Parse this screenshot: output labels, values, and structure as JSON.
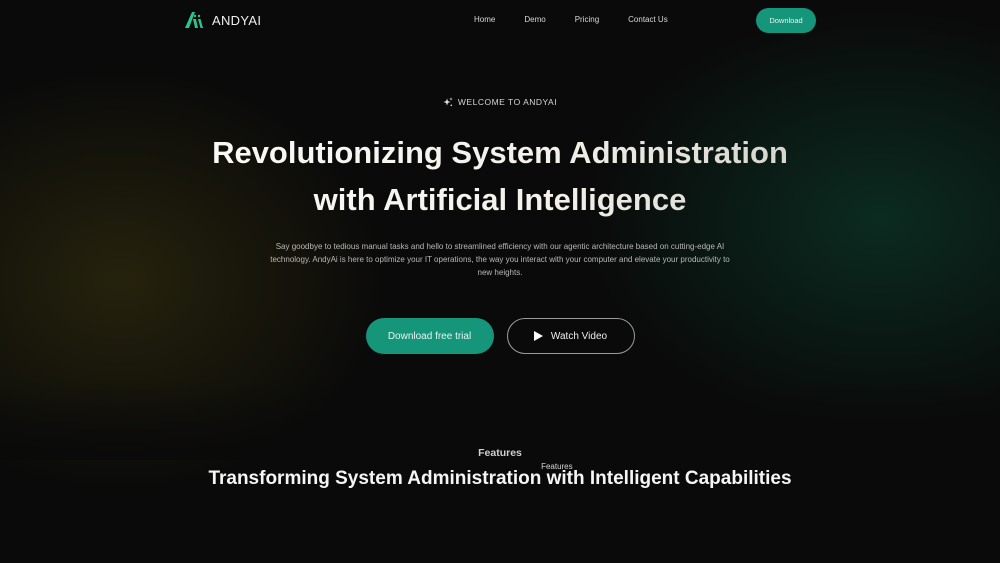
{
  "brand": {
    "name": "ANDYAI",
    "logo_icon": "andyai-logo-icon",
    "accent_color": "#15957a"
  },
  "nav": {
    "links": [
      {
        "label": "Home"
      },
      {
        "label": "Features"
      },
      {
        "label": "Demo"
      },
      {
        "label": "Pricing"
      },
      {
        "label": "Contact Us"
      }
    ],
    "download_label": "Download"
  },
  "hero": {
    "eyebrow_icon": "sparkle-icon",
    "eyebrow": "WELCOME TO ANDYAI",
    "title_line1": "Revolutionizing System Administration",
    "title_line2": "with Artificial Intelligence",
    "subtitle": "Say goodbye to tedious manual tasks and hello to streamlined efficiency with our agentic architecture based on cutting-edge AI technology. AndyAi is here to optimize your IT operations, the way you interact with your computer and elevate your productivity to new heights.",
    "primary_cta": "Download free trial",
    "secondary_cta": "Watch Video",
    "secondary_cta_icon": "play-icon"
  },
  "features": {
    "label": "Features",
    "title": "Transforming System Administration with Intelligent Capabilities"
  }
}
